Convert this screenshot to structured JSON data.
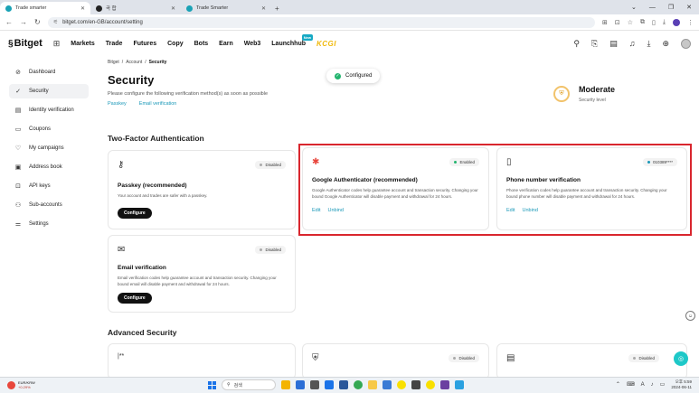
{
  "browser": {
    "tabs": [
      {
        "title": "Trade smarter",
        "active": true
      },
      {
        "title": "곡 합",
        "active": false
      },
      {
        "title": "Trade Smarter",
        "active": false
      }
    ],
    "new_tab": "+",
    "url": "bitget.com/en-GB/account/setting",
    "window_controls": [
      "⌄",
      "—",
      "❐",
      "✕"
    ]
  },
  "header": {
    "logo_text": "Bitget",
    "nav": [
      "Markets",
      "Trade",
      "Futures",
      "Copy",
      "Bots",
      "Earn",
      "Web3",
      "Launchhub"
    ],
    "new_badge": "New",
    "kcgi": "KCGI"
  },
  "sidebar": {
    "items": [
      {
        "label": "Dashboard",
        "icon": "⊘"
      },
      {
        "label": "Security",
        "icon": "✓"
      },
      {
        "label": "Identity verification",
        "icon": "▤"
      },
      {
        "label": "Coupons",
        "icon": "▭"
      },
      {
        "label": "My campaigns",
        "icon": "♡"
      },
      {
        "label": "Address book",
        "icon": "▣"
      },
      {
        "label": "API keys",
        "icon": "⊡"
      },
      {
        "label": "Sub-accounts",
        "icon": "⚇"
      },
      {
        "label": "Settings",
        "icon": "⚌"
      }
    ]
  },
  "main": {
    "breadcrumb": [
      "Bitget",
      "/",
      "Account",
      "/",
      "Security"
    ],
    "title": "Security",
    "subtitle": "Please configure the following verification method(s) as soon as possible",
    "method_links": [
      "Passkey",
      "Email verification"
    ],
    "toast": "Configured",
    "level": {
      "name": "Moderate",
      "label": "Security level"
    },
    "two_factor_title": "Two-Factor Authentication",
    "advanced_title": "Advanced Security"
  },
  "cards": {
    "passkey": {
      "status": "Disabled",
      "title": "Passkey (recommended)",
      "desc": "Your account and trades are safer with a passkey.",
      "button": "Configure"
    },
    "google": {
      "status": "Enabled",
      "title": "Google Authenticator (recommended)",
      "desc": "Google Authenticator codes help guarantee account and transaction security. Changing your bound Google Authenticator will disable payment and withdrawal for 24 hours.",
      "edit": "Edit",
      "unbind": "Unbind"
    },
    "phone": {
      "status": "010389****",
      "title": "Phone number verification",
      "desc": "Phone verification codes help guarantee account and transaction security. Changing your bound phone number will disable payment and withdrawal for 24 hours.",
      "edit": "Edit",
      "unbind": "Unbind"
    },
    "email": {
      "status": "Disabled",
      "title": "Email verification",
      "desc": "Email verification codes help guarantee account and transaction security. Changing your bound email will disable payment and withdrawal for 24 hours.",
      "button": "Configure"
    },
    "adv1": {
      "icon_text": "|**"
    },
    "adv2": {
      "status": "Disabled"
    },
    "adv3": {
      "status": "Disabled"
    }
  },
  "taskbar": {
    "weather_title": "EUR/KRW",
    "weather_sub": "+0.29%",
    "search_placeholder": "검색",
    "tray_lang": "A",
    "time": "오후 5:59",
    "date": "2024-06-11"
  },
  "colors": {
    "accent": "#1a98b8",
    "highlight_box": "#d9262e",
    "enabled": "#22b46e"
  }
}
